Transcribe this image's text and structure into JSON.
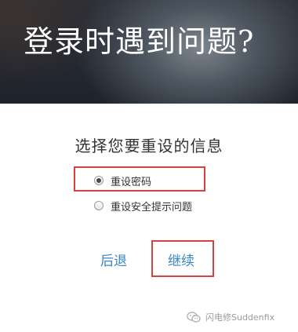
{
  "header": {
    "title": "登录时遇到问题?"
  },
  "form": {
    "prompt": "选择您要重设的信息",
    "options": [
      {
        "label": "重设密码",
        "selected": true
      },
      {
        "label": "重设安全提示问题",
        "selected": false
      }
    ]
  },
  "actions": {
    "back_label": "后退",
    "continue_label": "继续"
  },
  "watermark": {
    "text": "闪电修Suddenfix",
    "icon": "wechat-icon"
  },
  "colors": {
    "link": "#3a86c8",
    "highlight": "#d94040",
    "text": "#333333"
  }
}
